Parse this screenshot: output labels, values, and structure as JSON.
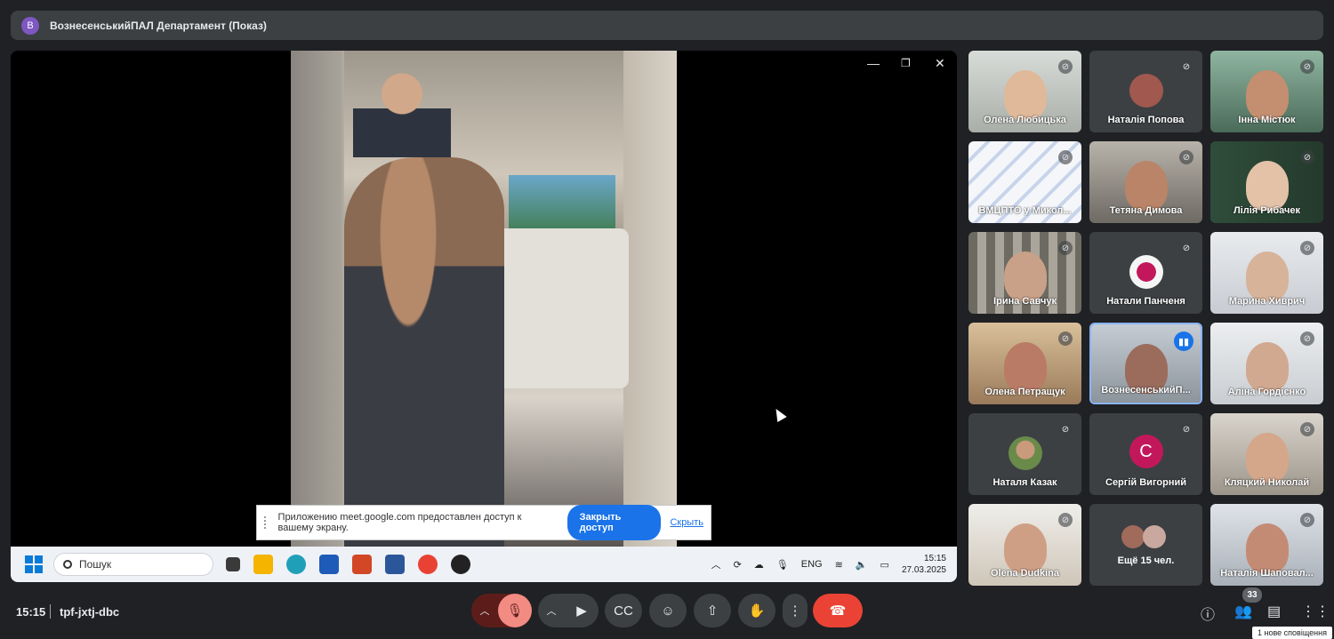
{
  "topbar": {
    "avatar_letter": "В",
    "title": "ВознесенськийПАЛ Департамент (Показ)"
  },
  "stage": {
    "window_controls": {
      "minimize": "—",
      "restore": "❐",
      "close": "✕"
    },
    "share_notice": {
      "text": "Приложению meet.google.com предоставлен доступ к вашему экрану.",
      "stop_label": "Закрыть доступ",
      "hide_label": "Скрыть"
    },
    "taskbar": {
      "search_placeholder": "Пошук",
      "language": "ENG",
      "time": "15:15",
      "date": "27.03.2025"
    }
  },
  "tiles": [
    {
      "name": "Олена Любицька",
      "muted": true
    },
    {
      "name": "Наталія Попова",
      "muted": true
    },
    {
      "name": "Інна Містюк",
      "muted": true
    },
    {
      "name": "ВМЦПТО у Микол...",
      "muted": true
    },
    {
      "name": "Тетяна Димова",
      "muted": true
    },
    {
      "name": "Лілія Рибачек",
      "muted": true
    },
    {
      "name": "Ірина Савчук",
      "muted": true
    },
    {
      "name": "Натали Панченя",
      "muted": true
    },
    {
      "name": "Марина Хиврич",
      "muted": true
    },
    {
      "name": "Олена Петращук",
      "muted": true
    },
    {
      "name": "ВознесенськийП...",
      "muted": false,
      "speaking": true
    },
    {
      "name": "Аліна Гордієнко",
      "muted": true
    },
    {
      "name": "Наталя Казак",
      "muted": true
    },
    {
      "name": "Сергій Вигорний",
      "muted": true,
      "letter": "С"
    },
    {
      "name": "Кляцкий Николай",
      "muted": true
    },
    {
      "name": "Olena Dudkina",
      "muted": true
    },
    {
      "more_label": "Ещё 15 чел."
    },
    {
      "name": "Наталія Шаповал...",
      "muted": true
    }
  ],
  "bottom": {
    "time": "15:15",
    "meeting_code": "tpf-jxtj-dbc",
    "participants_count": "33",
    "notification": "1 нове сповіщення"
  },
  "colors": {
    "accent": "#1a73e8",
    "end_call": "#ea4335",
    "mic_off": "#f28b82"
  }
}
